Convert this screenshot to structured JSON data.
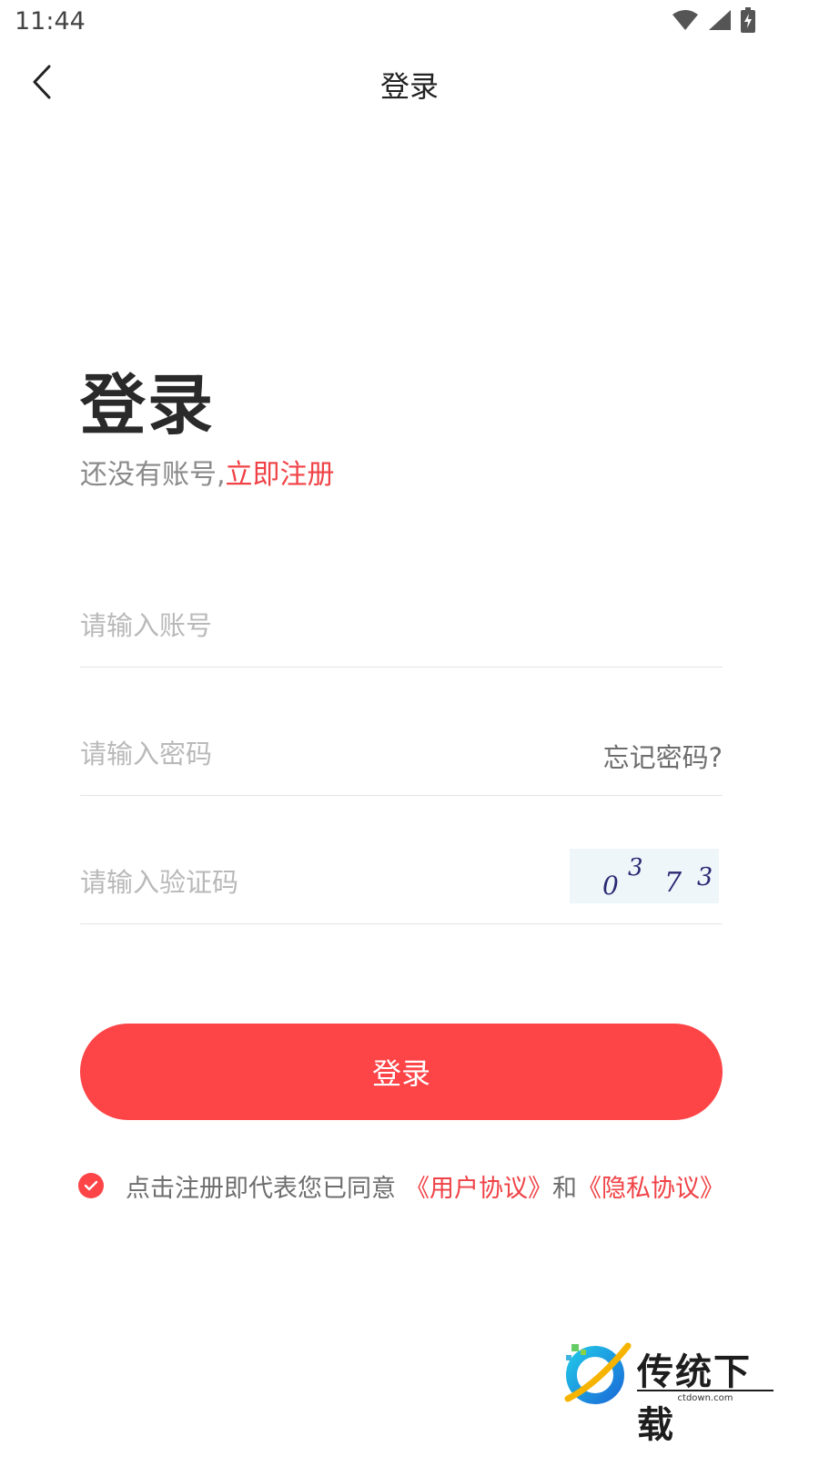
{
  "status_bar": {
    "time": "11:44"
  },
  "nav": {
    "title": "登录"
  },
  "main": {
    "heading": "登录",
    "no_account_text": "还没有账号,",
    "register_link": "立即注册"
  },
  "form": {
    "account_placeholder": "请输入账号",
    "password_placeholder": "请输入密码",
    "forgot_label": "忘记密码?",
    "captcha_placeholder": "请输入验证码",
    "captcha_chars": [
      "0",
      "3",
      "7",
      "3"
    ]
  },
  "login_button": "登录",
  "agreement": {
    "checked": true,
    "text": "点击注册即代表您已同意",
    "user_agreement": "《用户协议》",
    "and": "和",
    "privacy_agreement": "《隐私协议》"
  },
  "watermark": {
    "brand": "传统下载",
    "domain": "ctdown.com"
  },
  "colors": {
    "accent": "#fd4447",
    "link": "#f04246"
  }
}
